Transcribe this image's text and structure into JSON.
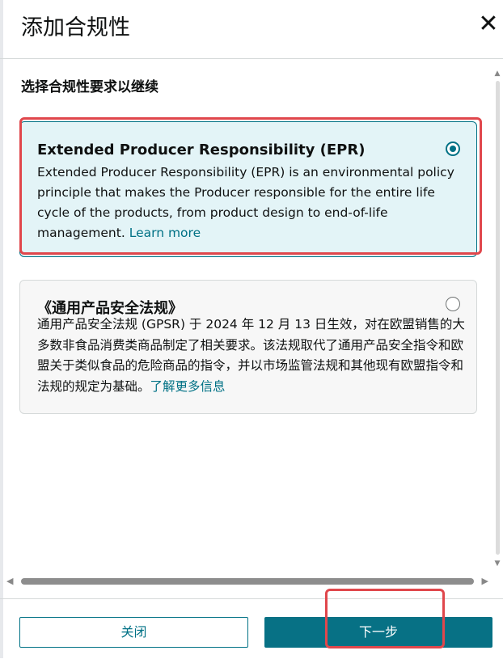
{
  "dialog": {
    "title": "添加合规性",
    "close_icon": "close-icon",
    "prompt": "选择合规性要求以继续"
  },
  "options": [
    {
      "title": "Extended Producer Responsibility (EPR)",
      "description": "Extended Producer Responsibility (EPR) is an environmental policy principle that makes the Producer responsible for the entire life cycle of the products, from product design to end-of-life management.",
      "learn_more": "Learn more",
      "selected": true
    },
    {
      "title": "《通用产品安全法规》",
      "description": "通用产品安全法规 (GPSR) 于 2024 年 12 月 13 日生效，对在欧盟销售的大多数非食品消费类商品制定了相关要求。该法规取代了通用产品安全指令和欧盟关于类似食品的危险商品的指令，并以市场监管法规和其他现有欧盟指令和法规的规定为基础。",
      "learn_more": "了解更多信息",
      "selected": false
    }
  ],
  "footer": {
    "close_label": "关闭",
    "next_label": "下一步"
  },
  "colors": {
    "accent": "#007185",
    "selected_bg": "#e3f4f7",
    "highlight": "#e0474c"
  }
}
